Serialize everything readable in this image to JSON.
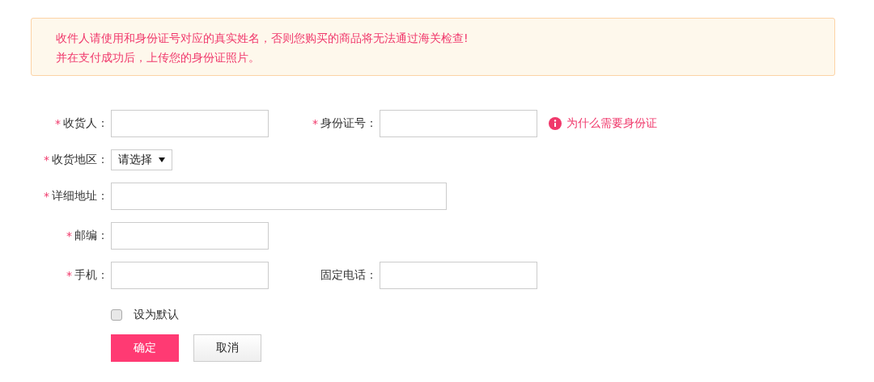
{
  "notice": {
    "lines": [
      "收件人请使用和身份证号对应的真实姓名，否则您购买的商品将无法通过海关检查!",
      "并在支付成功后，上传您的身份证照片。"
    ]
  },
  "rows": [
    {
      "fields": [
        {
          "kind": "input",
          "required": true,
          "marker": "*",
          "label": "收货人："
        },
        {
          "kind": "input",
          "required": true,
          "marker": "*",
          "label": "身份证号："
        }
      ],
      "help_link": {
        "text": "为什么需要身份证"
      }
    },
    {
      "fields": [
        {
          "kind": "select",
          "required": true,
          "marker": "*",
          "label": "收货地区：",
          "value": "请选择"
        }
      ]
    },
    {
      "fields": [
        {
          "kind": "wide",
          "required": true,
          "marker": "*",
          "label": "详细地址："
        }
      ]
    },
    {
      "fields": [
        {
          "kind": "input",
          "required": true,
          "marker": "*",
          "label": "邮编："
        }
      ]
    },
    {
      "fields": [
        {
          "kind": "input",
          "required": true,
          "marker": "*",
          "label": "手机："
        },
        {
          "kind": "input",
          "required": false,
          "label": "固定电话："
        }
      ]
    }
  ],
  "default_checkbox": {
    "label": "设为默认",
    "checked": false
  },
  "buttons": [
    {
      "label": "确定",
      "kind": "primary"
    },
    {
      "label": "取消",
      "kind": "secondary"
    }
  ]
}
